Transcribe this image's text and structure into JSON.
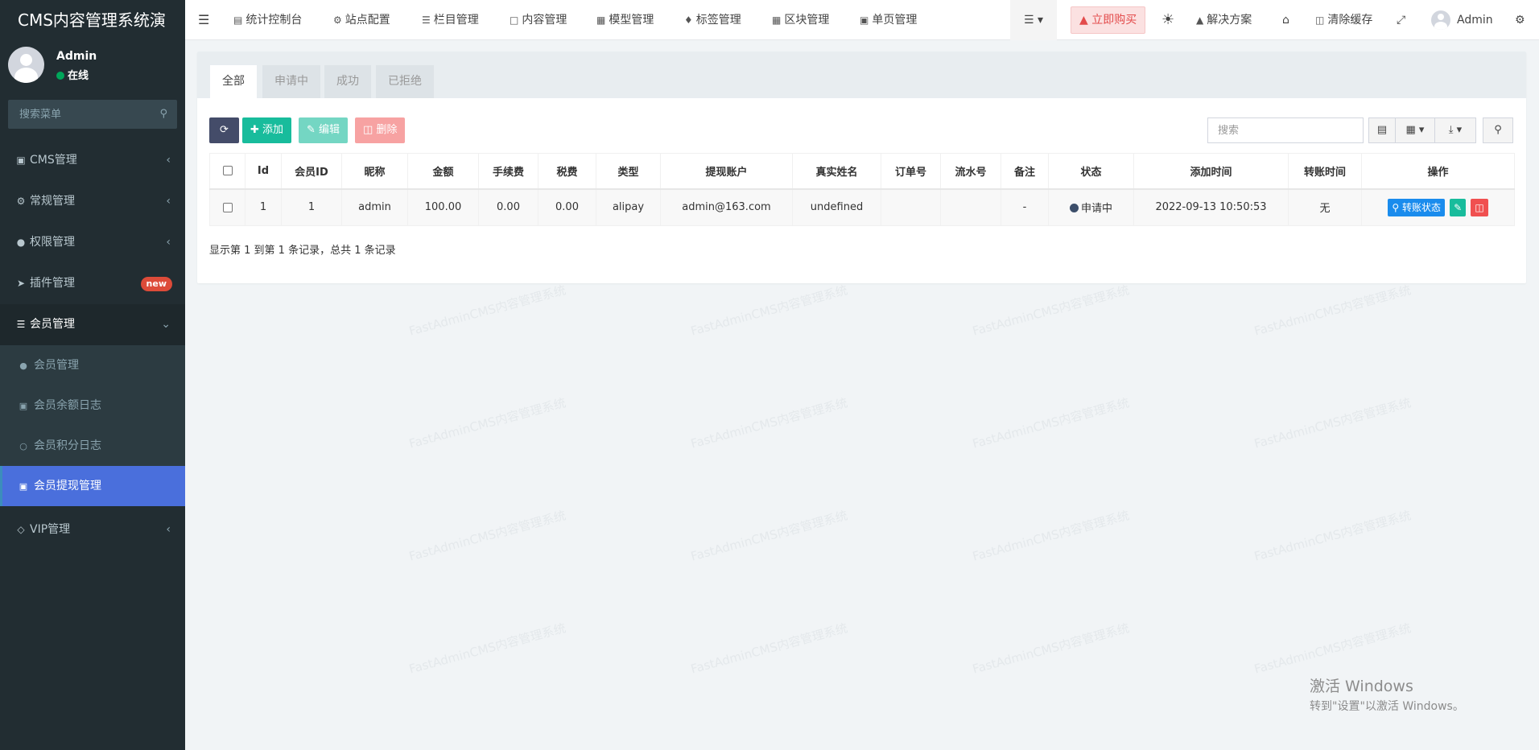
{
  "app": {
    "title": "CMS内容管理系统演",
    "user": {
      "name": "Admin",
      "status": "在线"
    },
    "search_placeholder": "搜索菜单"
  },
  "sidebar": {
    "items": [
      {
        "label": "CMS管理",
        "icon": "file-icon"
      },
      {
        "label": "常规管理",
        "icon": "cogs-icon"
      },
      {
        "label": "权限管理",
        "icon": "users-icon"
      },
      {
        "label": "插件管理",
        "icon": "rocket-icon",
        "badge": "new"
      },
      {
        "label": "会员管理",
        "icon": "list-icon",
        "open": true
      }
    ],
    "sub_items": [
      {
        "label": "会员管理",
        "icon": "user-icon"
      },
      {
        "label": "会员余额日志",
        "icon": "money-icon"
      },
      {
        "label": "会员积分日志",
        "icon": "circle-icon"
      },
      {
        "label": "会员提现管理",
        "icon": "money-icon",
        "active": true
      }
    ],
    "vip": {
      "label": "VIP管理",
      "icon": "diamond-icon"
    }
  },
  "topnav": {
    "items": [
      "统计控制台",
      "站点配置",
      "栏目管理",
      "内容管理",
      "模型管理",
      "标签管理",
      "区块管理",
      "单页管理"
    ],
    "buy": "立即购买",
    "solutions": "解决方案",
    "clear_cache": "清除缓存",
    "admin": "Admin"
  },
  "tabs": [
    "全部",
    "申请中",
    "成功",
    "已拒绝"
  ],
  "toolbar": {
    "add": "添加",
    "edit": "编辑",
    "delete": "删除",
    "search_placeholder": "搜索"
  },
  "table": {
    "headers": [
      "Id",
      "会员ID",
      "昵称",
      "金额",
      "手续费",
      "税费",
      "类型",
      "提现账户",
      "真实姓名",
      "订单号",
      "流水号",
      "备注",
      "状态",
      "添加时间",
      "转账时间",
      "操作"
    ],
    "rows": [
      {
        "id": "1",
        "member_id": "1",
        "nickname": "admin",
        "amount": "100.00",
        "fee": "0.00",
        "tax": "0.00",
        "type": "alipay",
        "account": "admin@163.com",
        "real_name": "undefined",
        "order_no": "",
        "serial_no": "",
        "memo": "-",
        "status": "申请中",
        "added": "2022-09-13 10:50:53",
        "transfer_time": "无"
      }
    ],
    "op_transfer": "转账状态"
  },
  "pagination_info": "显示第 1 到第 1 条记录，总共 1 条记录",
  "watermark": "FastAdminCMS内容管理系统",
  "windows": {
    "line1": "激活 Windows",
    "line2": "转到\"设置\"以激活 Windows。"
  },
  "colors": {
    "sidebar_bg": "#222d32",
    "active": "#4a6fdc",
    "add": "#18bc9c",
    "delete": "#f05050",
    "primary": "#3c8dbc"
  }
}
